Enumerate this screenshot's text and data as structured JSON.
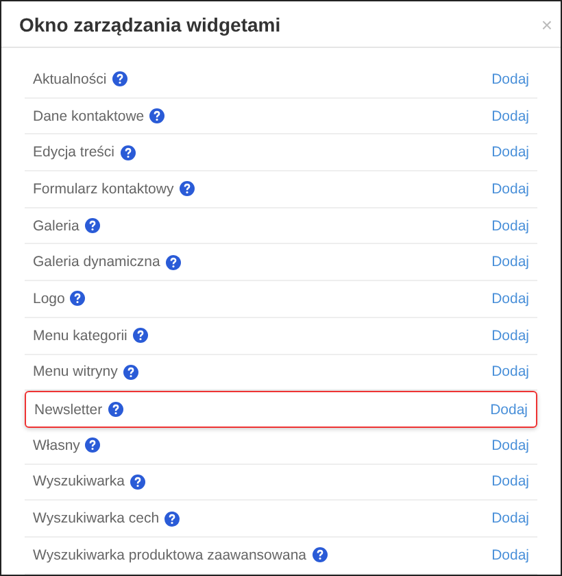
{
  "window": {
    "title": "Okno zarządzania widgetami",
    "close": "×"
  },
  "rows": [
    {
      "name": "Aktualności",
      "action": "Dodaj",
      "highlighted": false
    },
    {
      "name": "Dane kontaktowe",
      "action": "Dodaj",
      "highlighted": false
    },
    {
      "name": "Edycja treści",
      "action": "Dodaj",
      "highlighted": false
    },
    {
      "name": "Formularz kontaktowy",
      "action": "Dodaj",
      "highlighted": false
    },
    {
      "name": "Galeria",
      "action": "Dodaj",
      "highlighted": false
    },
    {
      "name": "Galeria dynamiczna",
      "action": "Dodaj",
      "highlighted": false
    },
    {
      "name": "Logo",
      "action": "Dodaj",
      "highlighted": false
    },
    {
      "name": "Menu kategorii",
      "action": "Dodaj",
      "highlighted": false
    },
    {
      "name": "Menu witryny",
      "action": "Dodaj",
      "highlighted": false
    },
    {
      "name": "Newsletter",
      "action": "Dodaj",
      "highlighted": true
    },
    {
      "name": "Własny",
      "action": "Dodaj",
      "highlighted": false
    },
    {
      "name": "Wyszukiwarka",
      "action": "Dodaj",
      "highlighted": false
    },
    {
      "name": "Wyszukiwarka cech",
      "action": "Dodaj",
      "highlighted": false
    },
    {
      "name": "Wyszukiwarka produktowa zaawansowana",
      "action": "Dodaj",
      "highlighted": false
    }
  ]
}
